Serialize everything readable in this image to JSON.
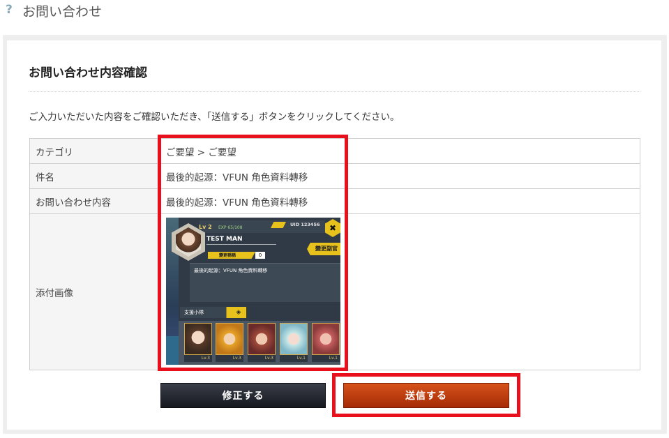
{
  "header": {
    "icon": "question-icon",
    "title": "お問い合わせ"
  },
  "panel": {
    "title": "お問い合わせ内容確認",
    "intro": "ご入力いただいた内容をご確認いただき、「送信する」ボタンをクリックしてください。"
  },
  "table": {
    "rows": [
      {
        "label": "カテゴリ",
        "value": "ご要望 > ご要望"
      },
      {
        "label": "件名",
        "value": "最後的起源：VFUN 角色資料轉移"
      },
      {
        "label": "お問い合わせ内容",
        "value": "最後的起源：VFUN 角色資料轉移"
      },
      {
        "label": "添付画像",
        "value": ""
      }
    ]
  },
  "attachment": {
    "level": "Lv 2",
    "exp": "EXP 65/108",
    "uid": "UID 123456",
    "close": "✖",
    "name": "TEST MAN",
    "change_button": "變更副官",
    "title_label": "變更稱稱",
    "title_value": "0",
    "signature": "最後的起源：VFUN 角色資料轉移",
    "support_label": "支援小隊",
    "characters": [
      {
        "lv": "Lv.3"
      },
      {
        "lv": "Lv.3"
      },
      {
        "lv": "Lv.3"
      },
      {
        "lv": "Lv.1"
      },
      {
        "lv": "Lv.1"
      }
    ]
  },
  "buttons": {
    "fix": "修正する",
    "send": "送信する"
  },
  "colors": {
    "highlight": "#e8101c",
    "send_button": "#b8360c",
    "fix_button": "#1e222a"
  }
}
